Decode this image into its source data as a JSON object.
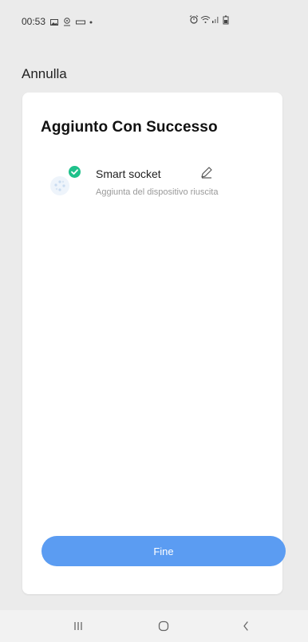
{
  "status_bar": {
    "time": "00:53",
    "left_icons": [
      "gallery-icon",
      "location-icon",
      "message-icon",
      "dot-icon"
    ],
    "right_icons": [
      "alarm-icon",
      "wifi-icon",
      "signal-icon",
      "battery-icon"
    ]
  },
  "header": {
    "cancel_label": "Annulla"
  },
  "card": {
    "title": "Aggiunto Con Successo",
    "device": {
      "name": "Smart socket",
      "status": "Aggiunta del dispositivo riuscita",
      "icon": "device-icon",
      "badge": "check-icon",
      "edit_icon": "pencil-icon"
    },
    "done_label": "Fine"
  },
  "colors": {
    "accent": "#5b9cf2",
    "success": "#1fc18b",
    "background": "#ebebeb",
    "card": "#ffffff"
  },
  "nav": {
    "buttons": [
      "recents-icon",
      "home-icon",
      "back-icon"
    ]
  }
}
